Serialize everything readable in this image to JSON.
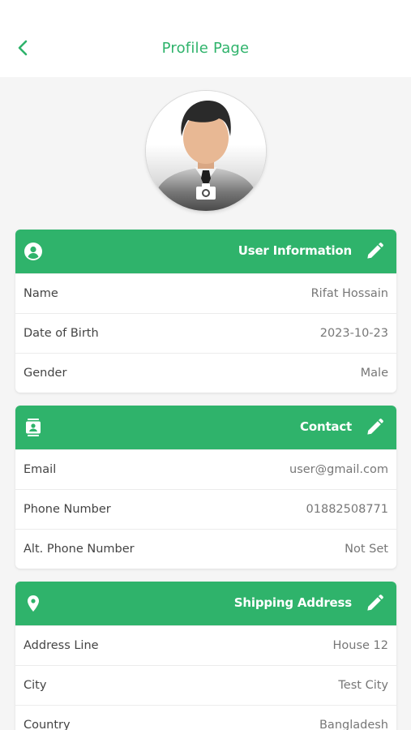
{
  "header": {
    "title": "Profile Page",
    "back_icon": "chevron-left-icon",
    "accent": "#2fb36b"
  },
  "avatar": {
    "camera_icon": "camera-icon"
  },
  "sections": {
    "user": {
      "title": "User Information",
      "icon": "account-circle-icon",
      "rows": [
        {
          "label": "Name",
          "value": "Rifat Hossain"
        },
        {
          "label": "Date of Birth",
          "value": "2023-10-23"
        },
        {
          "label": "Gender",
          "value": "Male"
        }
      ]
    },
    "contact": {
      "title": "Contact",
      "icon": "contact-card-icon",
      "rows": [
        {
          "label": "Email",
          "value": "user@gmail.com"
        },
        {
          "label": "Phone Number",
          "value": "01882508771"
        },
        {
          "label": "Alt. Phone Number",
          "value": "Not Set"
        }
      ]
    },
    "shipping": {
      "title": "Shipping Address",
      "icon": "location-pin-icon",
      "rows": [
        {
          "label": "Address Line",
          "value": "House 12"
        },
        {
          "label": "City",
          "value": "Test City"
        },
        {
          "label": "Country",
          "value": "Bangladesh"
        }
      ]
    }
  },
  "colors": {
    "primary": "#2fb36b",
    "background": "#f5f5f5",
    "card": "#ffffff"
  }
}
